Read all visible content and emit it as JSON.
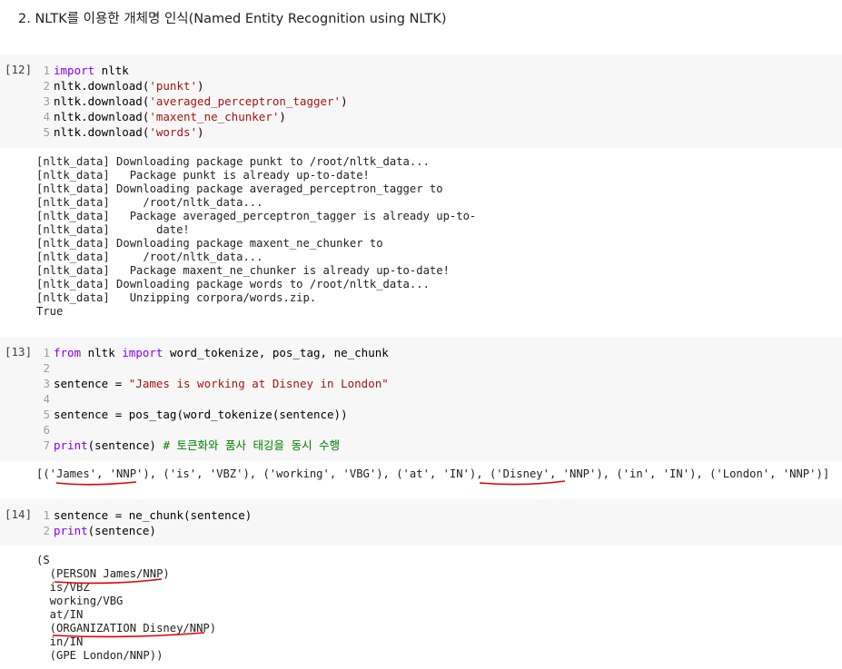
{
  "heading": "2. NLTK를 이용한 개체명 인식(Named Entity Recognition using NLTK)",
  "cells": [
    {
      "label": "[12]",
      "lines": [
        [
          {
            "t": "import",
            "c": "kw"
          },
          {
            "t": " nltk",
            "c": ""
          }
        ],
        [
          {
            "t": "nltk.download(",
            "c": ""
          },
          {
            "t": "'punkt'",
            "c": "str"
          },
          {
            "t": ")",
            "c": ""
          }
        ],
        [
          {
            "t": "nltk.download(",
            "c": ""
          },
          {
            "t": "'averaged_perceptron_tagger'",
            "c": "str"
          },
          {
            "t": ")",
            "c": ""
          }
        ],
        [
          {
            "t": "nltk.download(",
            "c": ""
          },
          {
            "t": "'maxent_ne_chunker'",
            "c": "str"
          },
          {
            "t": ")",
            "c": ""
          }
        ],
        [
          {
            "t": "nltk.download(",
            "c": ""
          },
          {
            "t": "'words'",
            "c": "str"
          },
          {
            "t": ")",
            "c": ""
          }
        ]
      ],
      "output": [
        "[nltk_data] Downloading package punkt to /root/nltk_data...",
        "[nltk_data]   Package punkt is already up-to-date!",
        "[nltk_data] Downloading package averaged_perceptron_tagger to",
        "[nltk_data]     /root/nltk_data...",
        "[nltk_data]   Package averaged_perceptron_tagger is already up-to-",
        "[nltk_data]       date!",
        "[nltk_data] Downloading package maxent_ne_chunker to",
        "[nltk_data]     /root/nltk_data...",
        "[nltk_data]   Package maxent_ne_chunker is already up-to-date!",
        "[nltk_data] Downloading package words to /root/nltk_data...",
        "[nltk_data]   Unzipping corpora/words.zip.",
        "True"
      ]
    },
    {
      "label": "[13]",
      "lines": [
        [
          {
            "t": "from",
            "c": "kw"
          },
          {
            "t": " nltk ",
            "c": ""
          },
          {
            "t": "import",
            "c": "kw"
          },
          {
            "t": " word_tokenize, pos_tag, ne_chunk",
            "c": ""
          }
        ],
        [],
        [
          {
            "t": "sentence = ",
            "c": ""
          },
          {
            "t": "\"James is working at Disney in London\"",
            "c": "str"
          }
        ],
        [],
        [
          {
            "t": "sentence = pos_tag(word_tokenize(sentence))",
            "c": ""
          }
        ],
        [],
        [
          {
            "t": "print",
            "c": "kw2"
          },
          {
            "t": "(sentence) ",
            "c": ""
          },
          {
            "t": "# 토큰화와 품사 태깅을 동시 수행",
            "c": "cmt"
          }
        ]
      ],
      "output": [
        "[('James', 'NNP'), ('is', 'VBZ'), ('working', 'VBG'), ('at', 'IN'), ('Disney', 'NNP'), ('in', 'IN'), ('London', 'NNP')]"
      ]
    },
    {
      "label": "[14]",
      "lines": [
        [
          {
            "t": "sentence = ne_chunk(sentence)",
            "c": ""
          }
        ],
        [
          {
            "t": "print",
            "c": "kw2"
          },
          {
            "t": "(sentence)",
            "c": ""
          }
        ]
      ],
      "output": [
        "(S",
        "  (PERSON James/NNP)",
        "  is/VBZ",
        "  working/VBG",
        "  at/IN",
        "  (ORGANIZATION Disney/NNP)",
        "  in/IN",
        "  (GPE London/NNP))"
      ]
    }
  ]
}
